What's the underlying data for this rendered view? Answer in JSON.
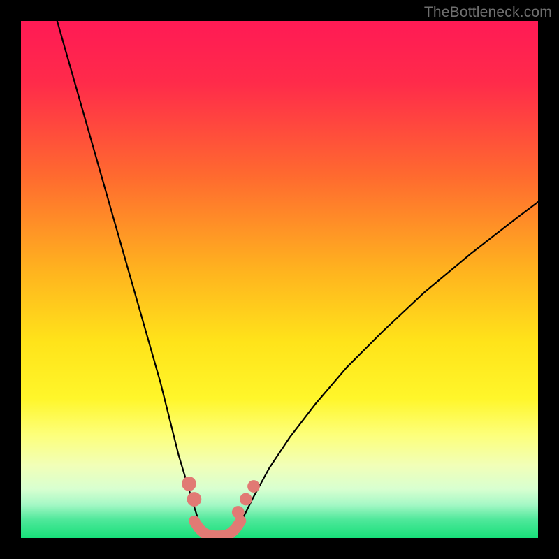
{
  "watermark": "TheBottleneck.com",
  "chart_data": {
    "type": "line",
    "title": "",
    "xlabel": "",
    "ylabel": "",
    "xlim": [
      0,
      100
    ],
    "ylim": [
      0,
      100
    ],
    "background_gradient_stops": [
      {
        "pos": 0.0,
        "color": "#ff1a55"
      },
      {
        "pos": 0.12,
        "color": "#ff2b4a"
      },
      {
        "pos": 0.3,
        "color": "#ff6a2f"
      },
      {
        "pos": 0.48,
        "color": "#ffb21f"
      },
      {
        "pos": 0.62,
        "color": "#ffe31a"
      },
      {
        "pos": 0.73,
        "color": "#fff62a"
      },
      {
        "pos": 0.8,
        "color": "#fdff7a"
      },
      {
        "pos": 0.86,
        "color": "#f1ffb8"
      },
      {
        "pos": 0.905,
        "color": "#d8ffd0"
      },
      {
        "pos": 0.935,
        "color": "#a6f8c6"
      },
      {
        "pos": 0.965,
        "color": "#4ee89a"
      },
      {
        "pos": 1.0,
        "color": "#17df79"
      }
    ],
    "series": [
      {
        "name": "left-curve",
        "stroke": "#000000",
        "x": [
          7,
          9,
          11,
          13,
          15,
          17,
          19,
          21,
          23,
          25,
          27,
          29,
          30.5,
          32,
          33.2,
          34.3,
          35.2
        ],
        "y": [
          100,
          93,
          86,
          79,
          72,
          65,
          58,
          51,
          44,
          37,
          30,
          22,
          16,
          11,
          7,
          3.5,
          1.5
        ]
      },
      {
        "name": "right-curve",
        "stroke": "#000000",
        "x": [
          41.5,
          43,
          45,
          48,
          52,
          57,
          63,
          70,
          78,
          87,
          96,
          100
        ],
        "y": [
          1.5,
          4,
          8,
          13.5,
          19.5,
          26,
          33,
          40,
          47.5,
          55,
          62,
          65
        ]
      },
      {
        "name": "floor-band",
        "stroke": "#e17a74",
        "x": [
          33.5,
          34.5,
          35.5,
          36.5,
          37.5,
          38.5,
          39.5,
          40.5,
          41.5,
          42.5
        ],
        "y": [
          3.3,
          1.8,
          0.9,
          0.5,
          0.4,
          0.4,
          0.5,
          0.9,
          1.8,
          3.3
        ]
      }
    ],
    "markers": [
      {
        "name": "left-dot-1",
        "x": 32.5,
        "y": 10.5,
        "r": 1.4,
        "color": "#e17a74"
      },
      {
        "name": "left-dot-2",
        "x": 33.5,
        "y": 7.5,
        "r": 1.4,
        "color": "#e17a74"
      },
      {
        "name": "right-dot-1",
        "x": 42.0,
        "y": 5.0,
        "r": 1.2,
        "color": "#e17a74"
      },
      {
        "name": "right-dot-2",
        "x": 43.5,
        "y": 7.5,
        "r": 1.2,
        "color": "#e17a74"
      },
      {
        "name": "right-dot-3",
        "x": 45.0,
        "y": 10.0,
        "r": 1.2,
        "color": "#e17a74"
      }
    ]
  }
}
